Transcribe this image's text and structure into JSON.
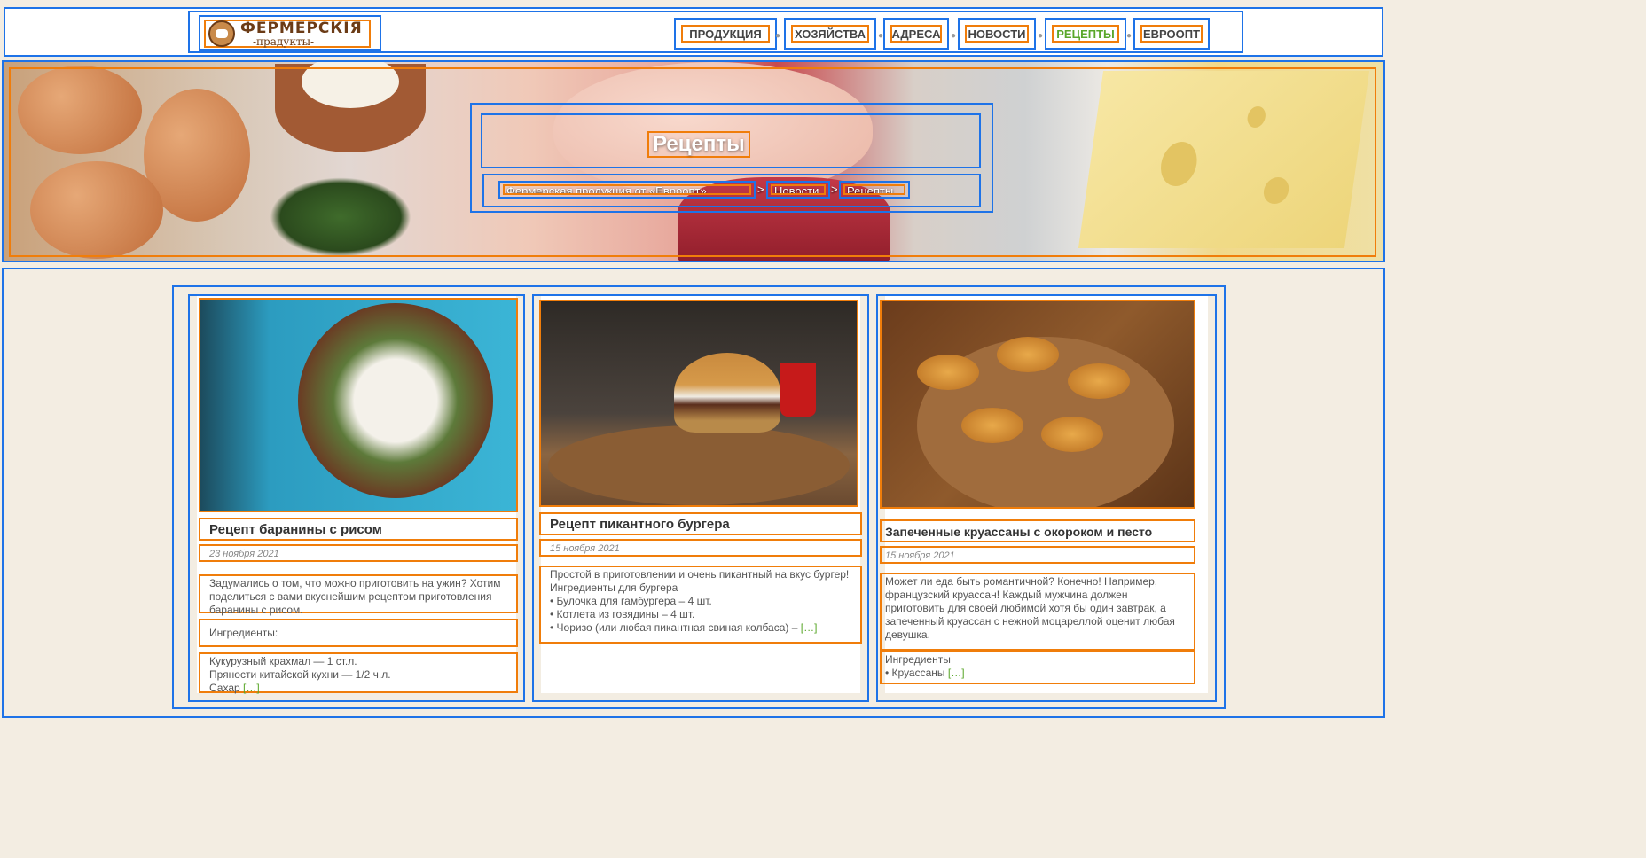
{
  "header": {
    "logo_line1": "ФЕРМЕРСКIЯ",
    "logo_line2": "-прадукты-",
    "nav": [
      {
        "label": "ПРОДУКЦИЯ",
        "active": false
      },
      {
        "label": "ХОЗЯЙСТВА",
        "active": false
      },
      {
        "label": "АДРЕСА",
        "active": false
      },
      {
        "label": "НОВОСТИ",
        "active": false
      },
      {
        "label": "РЕЦЕПТЫ",
        "active": true
      },
      {
        "label": "ЕВРООПТ",
        "active": false
      }
    ]
  },
  "hero": {
    "title": "Рецепты",
    "breadcrumbs": [
      "Фермерская продукция от «Евроопт»",
      "Новости",
      "Рецепты"
    ],
    "separator": ">"
  },
  "cards": [
    {
      "title": "Рецепт баранины с рисом",
      "date": "23 ноября 2021",
      "intro": "Задумались о том, что можно приготовить на ужин? Хотим поделиться с вами вкуснейшим рецептом приготовления баранины с рисом.",
      "ingredients_label": "Ингредиенты:",
      "ingredients": [
        "Кукурузный крахмал — 1 ст.л.",
        "Пряности китайской кухни — 1/2 ч.л.",
        "Сахар"
      ],
      "more": "[…]"
    },
    {
      "title": "Рецепт пикантного бургера",
      "date": "15 ноября 2021",
      "intro": "Простой в приготовлении и очень пикантный на вкус бургер!",
      "ingredients_label": "Ингредиенты для бургера",
      "ingredients": [
        "• Булочка для гамбургера – 4 шт.",
        "• Котлета из говядины  – 4 шт.",
        "• Чоризо (или любая пикантная свиная колбаса) –"
      ],
      "more": "[…]"
    },
    {
      "title": "Запеченные круассаны с окороком и песто",
      "date": "15 ноября 2021",
      "intro": "Может ли еда быть романтичной? Конечно! Например, французский круассан! Каждый мужчина должен приготовить для своей любимой хотя бы один завтрак, а запеченный круассан с нежной моцареллой оценит любая девушка.",
      "ingredients_label": "Ингредиенты",
      "ingredients": [
        "• Круассаны"
      ],
      "more": "[…]"
    }
  ],
  "colors": {
    "accent": "#5aa72a",
    "brand_brown": "#6b3b16"
  }
}
